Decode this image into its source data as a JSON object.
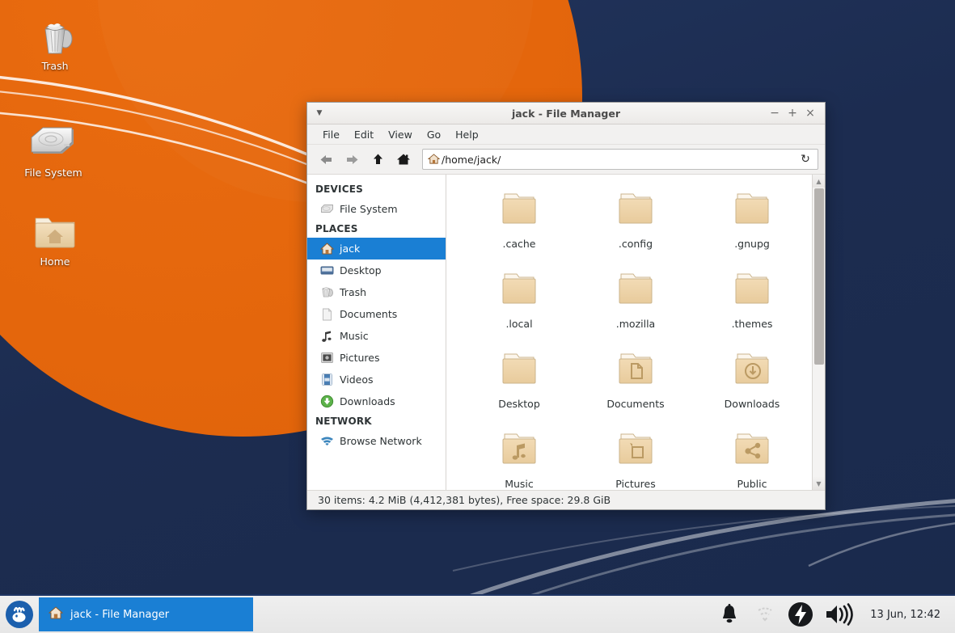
{
  "desktop": {
    "wallpaper": {
      "bg_color": "#1c2c50",
      "accent_color": "#e4660c"
    },
    "icons": [
      {
        "name": "Trash",
        "icon": "trash-icon"
      },
      {
        "name": "File System",
        "icon": "harddisk-icon"
      },
      {
        "name": "Home",
        "icon": "home-folder-icon"
      }
    ]
  },
  "file_manager": {
    "title": "jack - File Manager",
    "window_menu_icon": "window-menu-arrow-icon",
    "window_buttons": {
      "minimize": "−",
      "maximize": "+",
      "close": "×"
    },
    "menus": [
      "File",
      "Edit",
      "View",
      "Go",
      "Help"
    ],
    "toolbar": {
      "back": "back-arrow-icon",
      "forward": "forward-arrow-icon",
      "up": "up-arrow-icon",
      "home": "home-icon",
      "path": "/home/jack/",
      "reload": "reload-icon"
    },
    "sidebar": {
      "groups": [
        {
          "heading": "DEVICES",
          "items": [
            {
              "label": "File System",
              "icon": "harddisk-icon",
              "selected": false
            }
          ]
        },
        {
          "heading": "PLACES",
          "items": [
            {
              "label": "jack",
              "icon": "home-icon",
              "selected": true
            },
            {
              "label": "Desktop",
              "icon": "desktop-icon",
              "selected": false
            },
            {
              "label": "Trash",
              "icon": "trash-icon",
              "selected": false
            },
            {
              "label": "Documents",
              "icon": "document-icon",
              "selected": false
            },
            {
              "label": "Music",
              "icon": "music-note-icon",
              "selected": false
            },
            {
              "label": "Pictures",
              "icon": "picture-icon",
              "selected": false
            },
            {
              "label": "Videos",
              "icon": "video-icon",
              "selected": false
            },
            {
              "label": "Downloads",
              "icon": "download-icon",
              "selected": false
            }
          ]
        },
        {
          "heading": "NETWORK",
          "items": [
            {
              "label": "Browse Network",
              "icon": "network-wifi-icon",
              "selected": false
            }
          ]
        }
      ]
    },
    "files": [
      {
        "name": ".cache",
        "type": "folder",
        "emblem": "none"
      },
      {
        "name": ".config",
        "type": "folder",
        "emblem": "none"
      },
      {
        "name": ".gnupg",
        "type": "folder",
        "emblem": "none"
      },
      {
        "name": ".local",
        "type": "folder",
        "emblem": "none"
      },
      {
        "name": ".mozilla",
        "type": "folder",
        "emblem": "none"
      },
      {
        "name": ".themes",
        "type": "folder",
        "emblem": "none"
      },
      {
        "name": "Desktop",
        "type": "folder",
        "emblem": "none"
      },
      {
        "name": "Documents",
        "type": "folder",
        "emblem": "document"
      },
      {
        "name": "Downloads",
        "type": "folder",
        "emblem": "download"
      },
      {
        "name": "Music",
        "type": "folder",
        "emblem": "music"
      },
      {
        "name": "Pictures",
        "type": "folder",
        "emblem": "picture"
      },
      {
        "name": "Public",
        "type": "folder",
        "emblem": "share"
      }
    ],
    "statusbar": "30 items: 4.2 MiB (4,412,381 bytes), Free space: 29.8 GiB"
  },
  "taskbar": {
    "start_icon": "xfce-mouse-icon",
    "window_button": {
      "label": "jack - File Manager",
      "icon": "home-icon"
    },
    "tray": [
      {
        "name": "notification-bell-icon"
      },
      {
        "name": "network-disconnected-icon"
      },
      {
        "name": "power-bolt-icon"
      },
      {
        "name": "volume-icon"
      }
    ],
    "clock": "13 Jun, 12:42"
  }
}
